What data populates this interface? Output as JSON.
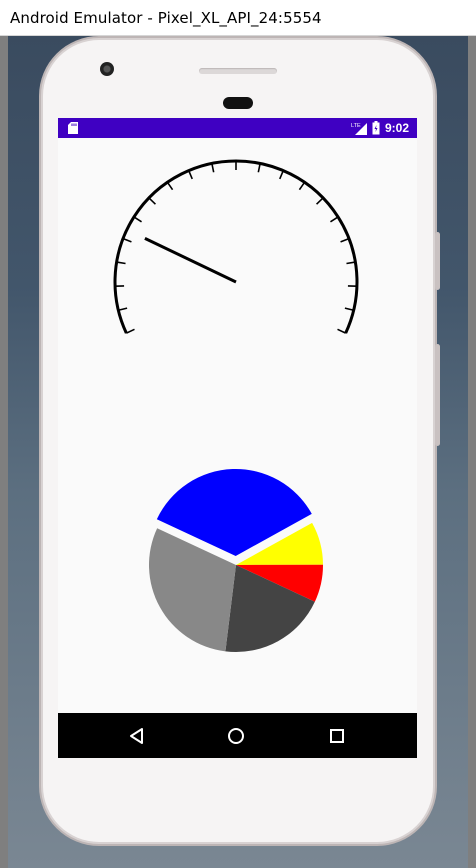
{
  "window": {
    "title": "Android Emulator - Pixel_XL_API_24:5554"
  },
  "status_bar": {
    "time": "9:02",
    "background": "#3f00c2",
    "network_label": "LTE"
  },
  "gauge": {
    "tick_count": 21,
    "needle_value_fraction": 0.22
  },
  "pie": {
    "type": "pie",
    "slices": [
      {
        "label": "blue",
        "color": "#0000ff",
        "value": 35,
        "exploded": true
      },
      {
        "label": "yellow",
        "color": "#ffff00",
        "value": 8
      },
      {
        "label": "red",
        "color": "#ff0000",
        "value": 7
      },
      {
        "label": "dark-gray",
        "color": "#444444",
        "value": 20
      },
      {
        "label": "gray",
        "color": "#888888",
        "value": 30
      }
    ]
  },
  "nav_bar": {
    "back": "back-icon",
    "home": "home-icon",
    "recents": "recents-icon"
  }
}
